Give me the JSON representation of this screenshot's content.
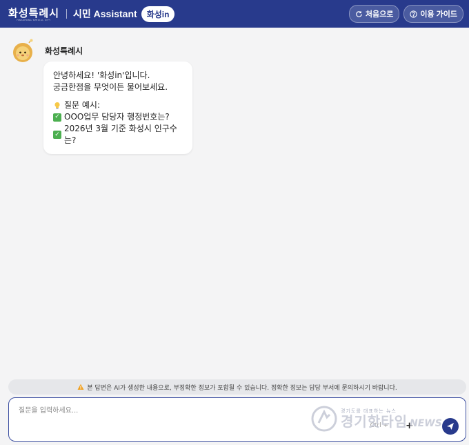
{
  "header": {
    "logo_text": "화성특례시",
    "logo_subtext": "HWASEONG SPECIAL CITY",
    "app_title": "시민 Assistant",
    "brand_pill": "화성in",
    "buttons": {
      "home_label": "처음으로",
      "guide_label": "이용 가이드"
    }
  },
  "chat": {
    "bot_name": "화성특례시",
    "greeting_line1": "안녕하세요! '화성in'입니다.",
    "greeting_line2": "궁금한점을 무엇이든 물어보세요.",
    "examples_heading": "질문 예시:",
    "examples": [
      "OOO업무 담당자 행정번호는?",
      "2026년 3월 기준 화성시 인구수는?"
    ]
  },
  "disclaimer": "본 답변은 AI가 생성한 내용으로, 부정확한 정보가 포함될 수 있습니다. 정확한 정보는 담당 부서에 문의하시기 바랍니다.",
  "input": {
    "placeholder": "질문을 입력하세요...",
    "value": "",
    "ctrl_hint": "Ctrl +"
  },
  "watermark": {
    "small": "경기도를 대표하는 뉴스",
    "main": "경기핫타임",
    "news": "NEWS"
  },
  "colors": {
    "header_bg": "#283a8c",
    "accent": "#283a8c",
    "background": "#f4f4f5",
    "check_green": "#4caf50"
  },
  "icons": {
    "home_button": "refresh-icon",
    "guide_button": "help-circle-icon",
    "avatar": "lion-mascot-icon",
    "example_heading": "lightbulb-icon",
    "example_item": "checkbox-icon",
    "disclaimer": "warning-icon",
    "send": "send-icon"
  }
}
